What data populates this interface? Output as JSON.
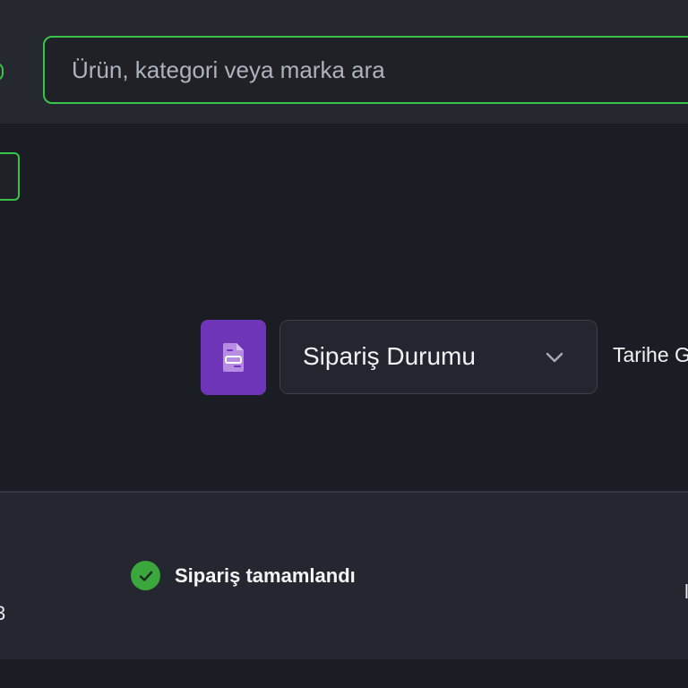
{
  "header": {
    "search": {
      "placeholder": "Ürün, kategori veya marka ara",
      "value": ""
    }
  },
  "filters": {
    "filter_icon": "document-filter-icon",
    "status_select": {
      "label": "Sipariş Durumu",
      "icon": "chevron-down-icon"
    },
    "sort_label_partial": "Tarihe G"
  },
  "order": {
    "status_icon": "check-circle-icon",
    "status_label": "Sipariş tamamlandı",
    "left_edge_partial": "3",
    "right_edge_partial": "l"
  },
  "colors": {
    "accent_green": "#38c34b",
    "filter_purple": "#6f35b9",
    "success_green": "#3aa63c",
    "background": "#1b1d24"
  }
}
